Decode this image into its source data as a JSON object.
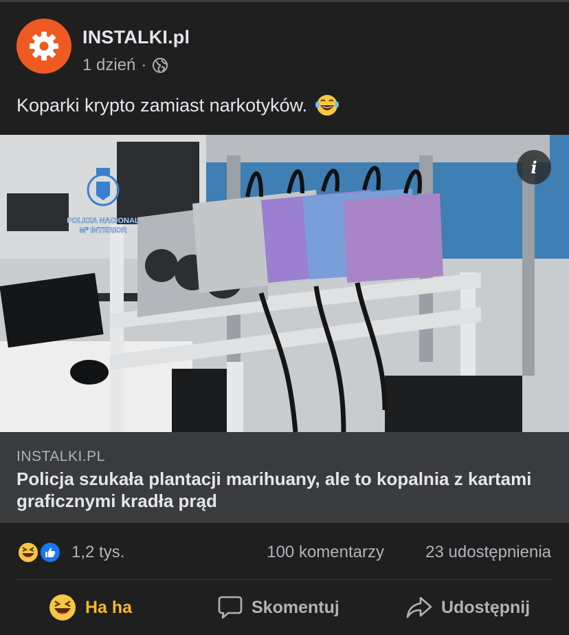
{
  "post": {
    "page_name": "INSTALKI.pl",
    "time": "1 dzień",
    "separator": "·",
    "privacy_icon": "globe-icon",
    "text": "Koparki krypto zamiast narkotyków.",
    "text_emoji": "laughing-tears-emoji",
    "avatar_icon": "gear-icon"
  },
  "link": {
    "domain": "INSTALKI.PL",
    "title": "Policja szukała plantacji marihuany, ale to kopalnia z kartami graficznymi kradła prąd",
    "image_watermark": [
      "POLICIA NACIONAL",
      "Mº INTERIOR"
    ],
    "info_label": "i"
  },
  "stats": {
    "reactions": [
      "haha",
      "like"
    ],
    "reaction_count": "1,2 tys.",
    "comments": "100 komentarzy",
    "shares": "23 udostępnienia"
  },
  "actions": {
    "haha": "Ha ha",
    "comment": "Skomentuj",
    "share": "Udostępnij"
  },
  "colors": {
    "background": "#1f1f20",
    "link_card": "#3a3b3c",
    "avatar": "#ef5a22",
    "haha_active": "#f7b928",
    "like_blue": "#1877f2",
    "text_primary": "#e4e6eb",
    "text_secondary": "#b0b3b8"
  }
}
